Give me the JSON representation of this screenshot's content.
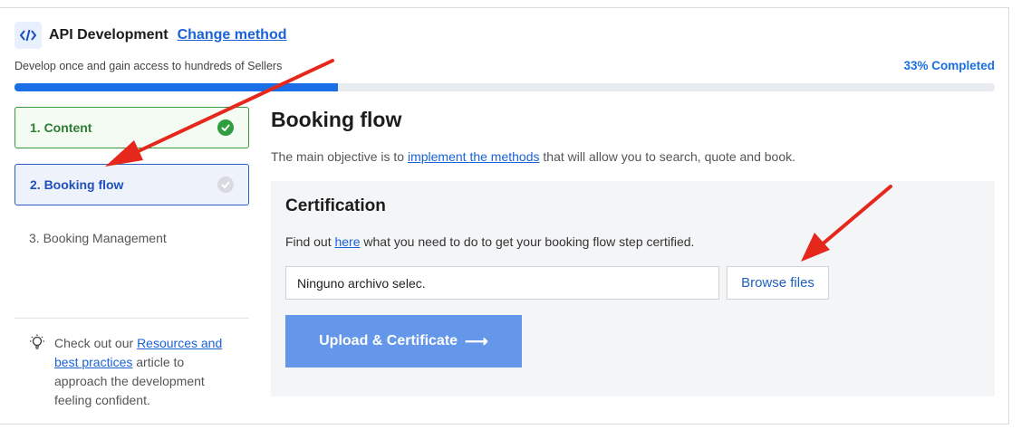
{
  "header": {
    "title": "API Development",
    "change_link": "Change method",
    "subtitle": "Develop once and gain access to hundreds of Sellers"
  },
  "progress": {
    "label": "33% Completed",
    "value": 0.33,
    "color": "#1a6fe6"
  },
  "steps": [
    {
      "label": "1. Content",
      "status": "completed"
    },
    {
      "label": "2. Booking flow",
      "status": "active"
    },
    {
      "label": "3. Booking Management",
      "status": "pending"
    }
  ],
  "tip": {
    "prefix": "Check out our ",
    "link": "Resources and best practices",
    "suffix": " article to approach the development feeling confident."
  },
  "main": {
    "title": "Booking flow",
    "desc_prefix": "The main objective is to ",
    "desc_link": "implement the methods",
    "desc_suffix": " that will allow you to search, quote and book."
  },
  "certification": {
    "title": "Certification",
    "desc_prefix": "Find out ",
    "desc_link": "here",
    "desc_suffix": " what you need to do to get your booking flow step certified.",
    "file_value": "Ninguno archivo selec.",
    "browse_label": "Browse files",
    "upload_label": "Upload & Certificate",
    "upload_color": "#6497ea"
  },
  "icons": {
    "header_icon": "code-icon",
    "tip_icon": "lightbulb-icon",
    "completed_icon": "check-circle-icon",
    "pending_icon": "pending-circle-icon",
    "upload_arrow": "arrow-right-icon"
  },
  "annotations": {
    "arrow_color": "#e5271c"
  }
}
